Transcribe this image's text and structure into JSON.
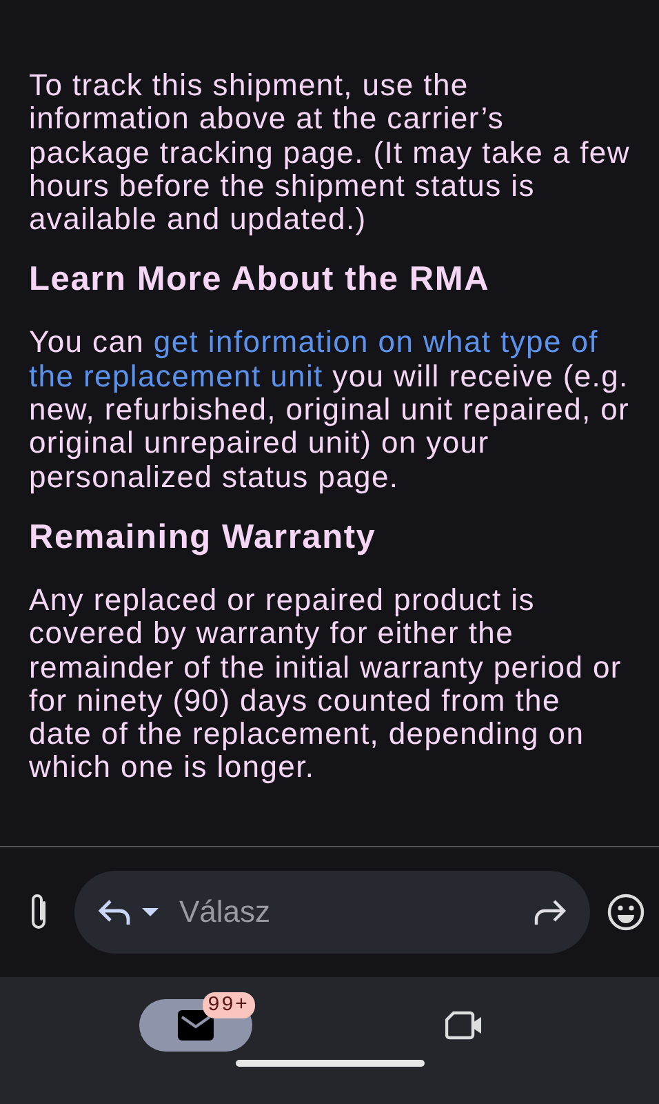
{
  "sections": [
    {
      "kind": "paragraph",
      "text": "To track this shipment, use the information above at the carrier’s package tracking page. (It may take a few hours before the shipment status is available and updated.)"
    },
    {
      "kind": "heading",
      "text": "Learn More About the RMA"
    },
    {
      "kind": "paragraph",
      "text": "You can",
      "link": [
        "get information on what type of",
        "the replacement unit"
      ],
      "after": "you will receive (e.g. new, refurbished, original unit repaired, or original unrepaired unit) on your personalized status page."
    },
    {
      "kind": "heading",
      "text": "Remaining Warranty"
    },
    {
      "kind": "paragraph",
      "text": "Any replaced or repaired product is covered by warranty for either the remainder of the initial warranty period or for ninety (90) days counted from the date of the replacement, depending on which one is longer."
    }
  ],
  "reply_bar": {
    "placeholder": "Válasz"
  },
  "bottom_nav": [
    {
      "kind": "mail",
      "selected": true,
      "badge": "99+"
    },
    {
      "kind": "video",
      "selected": false
    }
  ]
}
